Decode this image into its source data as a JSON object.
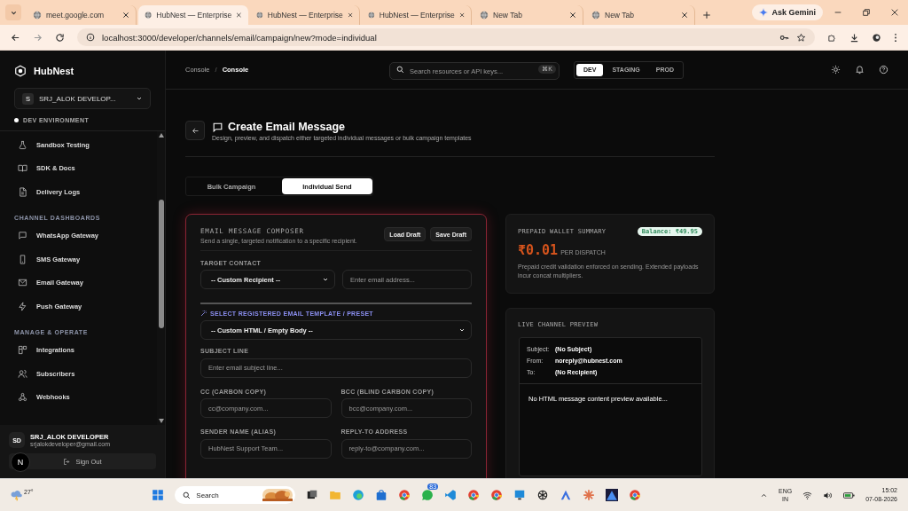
{
  "browser": {
    "tabs": [
      {
        "title": "meet.google.com",
        "selected": false
      },
      {
        "title": "HubNest — Enterprise",
        "selected": true
      },
      {
        "title": "HubNest — Enterprise",
        "selected": false
      },
      {
        "title": "HubNest — Enterprise",
        "selected": false
      },
      {
        "title": "New Tab",
        "selected": false
      },
      {
        "title": "New Tab",
        "selected": false
      }
    ],
    "ask_button": "Ask Gemini",
    "url": "localhost:3000/developer/channels/email/campaign/new?mode=individual"
  },
  "sidebar": {
    "brand": "HubNest",
    "account": {
      "initial": "S",
      "name": "SRJ_ALOK DEVELOP..."
    },
    "environment": "DEV ENVIRONMENT",
    "sections": [
      {
        "items": [
          {
            "label": "Sandbox Testing",
            "selected": false
          },
          {
            "label": "SDK & Docs",
            "selected": false
          },
          {
            "label": "Delivery Logs",
            "selected": false
          }
        ]
      },
      {
        "heading": "CHANNEL DASHBOARDS",
        "items": [
          {
            "label": "WhatsApp Gateway",
            "selected": false
          },
          {
            "label": "SMS Gateway",
            "selected": false
          },
          {
            "label": "Email Gateway",
            "selected": false
          },
          {
            "label": "Push Gateway",
            "selected": false
          }
        ]
      },
      {
        "heading": "MANAGE & OPERATE",
        "items": [
          {
            "label": "Integrations",
            "selected": false
          },
          {
            "label": "Subscribers",
            "selected": false
          },
          {
            "label": "Webhooks",
            "selected": false
          }
        ]
      }
    ],
    "user": {
      "initials": "SD",
      "name": "SRJ_ALOK DEVELOPER",
      "email": "srjalokdeveloper@gmail.com"
    },
    "dev_badge": "N",
    "sign_out": "Sign Out"
  },
  "header": {
    "breadcrumb": [
      "Console",
      "Console"
    ],
    "breadcrumb_separator": "/",
    "search_placeholder": "Search resources or API keys...",
    "shortcut": "⌘K",
    "environments": [
      {
        "label": "DEV",
        "selected": true
      },
      {
        "label": "STAGING",
        "selected": false
      },
      {
        "label": "PROD",
        "selected": false
      }
    ]
  },
  "page": {
    "title": "Create Email Message",
    "subtitle": "Design, preview, and dispatch either targeted individual messages or bulk campaign templates",
    "mode_tabs": [
      {
        "label": "Bulk Campaign",
        "selected": false
      },
      {
        "label": "Individual Send",
        "selected": true
      }
    ]
  },
  "composer": {
    "title": "EMAIL MESSAGE COMPOSER",
    "subtitle": "Send a single, targeted notification to a specific recipient.",
    "buttons": [
      "Load Draft",
      "Save Draft"
    ],
    "target_label": "TARGET CONTACT",
    "recipient_select": "-- Custom Recipient --",
    "email_placeholder": "Enter email address...",
    "template_label": "SELECT REGISTERED EMAIL TEMPLATE / PRESET",
    "template_select": "-- Custom HTML / Empty Body --",
    "subject_label": "SUBJECT LINE",
    "subject_placeholder": "Enter email subject line...",
    "pairs": [
      [
        {
          "label": "CC (CARBON COPY)",
          "placeholder": "cc@company.com..."
        },
        {
          "label": "BCC (BLIND CARBON COPY)",
          "placeholder": "bcc@company.com..."
        }
      ],
      [
        {
          "label": "SENDER NAME (ALIAS)",
          "placeholder": "HubNest Support Team..."
        },
        {
          "label": "REPLY-TO ADDRESS",
          "placeholder": "reply-to@company.com..."
        }
      ]
    ]
  },
  "wallet": {
    "title": "PREPAID WALLET SUMMARY",
    "balance": "Balance: ₹49.95",
    "price": "₹0.01",
    "unit": "PER DISPATCH",
    "note": "Prepaid credit validation enforced on sending. Extended payloads incur concat multipliers."
  },
  "preview": {
    "title": "LIVE CHANNEL PREVIEW",
    "headers": [
      {
        "label": "Subject:",
        "value": "(No Subject)"
      },
      {
        "label": "From:",
        "value": "noreply@hubnest.com"
      },
      {
        "label": "To:",
        "value": "(No Recipient)"
      }
    ],
    "body": "No HTML message content preview available..."
  },
  "taskbar": {
    "temperature": "27°",
    "search": "Search",
    "chat_badge": "83",
    "language": [
      "ENG",
      "IN"
    ],
    "time": "15:02",
    "date": "07-08-2026"
  }
}
